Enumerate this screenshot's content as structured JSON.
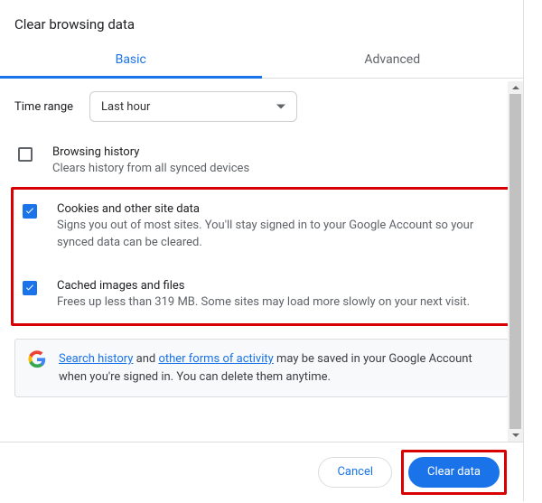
{
  "title": "Clear browsing data",
  "tabs": {
    "basic": "Basic",
    "advanced": "Advanced"
  },
  "time": {
    "label": "Time range",
    "value": "Last hour"
  },
  "options": {
    "browsing": {
      "checked": false,
      "title": "Browsing history",
      "desc": "Clears history from all synced devices"
    },
    "cookies": {
      "checked": true,
      "title": "Cookies and other site data",
      "desc": "Signs you out of most sites. You'll stay signed in to your Google Account so your synced data can be cleared."
    },
    "cache": {
      "checked": true,
      "title": "Cached images and files",
      "desc": "Frees up less than 319 MB. Some sites may load more slowly on your next visit."
    }
  },
  "info": {
    "link1": "Search history",
    "mid1": " and ",
    "link2": "other forms of activity",
    "rest": " may be saved in your Google Account when you're signed in. You can delete them anytime."
  },
  "buttons": {
    "cancel": "Cancel",
    "clear": "Clear data"
  }
}
